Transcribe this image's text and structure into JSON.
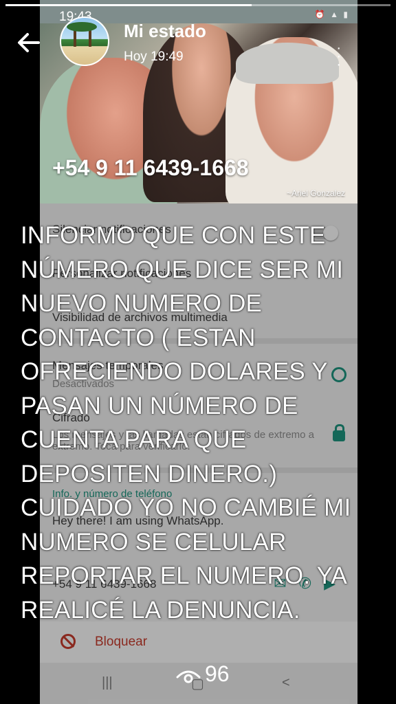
{
  "status": {
    "contact_name": "Mi estado",
    "timestamp": "Hoy 19:49",
    "progress_fraction": 0.64,
    "views_count": "96"
  },
  "caption": {
    "text": "INFORMO QUE CON ESTE\nNÚMERO QUE DICE SER MI\nNUEVO NUMERO DE\nCONTACTO  ( ESTAN\nOFRECIENDO DOLARES Y\nPASAN UN NÚMERO DE\nCUENTA PARA QUE\nDEPOSITEN DINERO.)\nCUIDADO YO NO CAMBIÉ MI\nNUMERO SE CELULAR\nREPORTAR EL NUMERO. YA\nREALICÉ LA DENUNCIA."
  },
  "embedded_screenshot": {
    "phone_status_time": "19:43",
    "photo_phone_number": "+54 9 11 6439-1668",
    "photo_credit": "~Ariel Gonzalez",
    "settings_rows": [
      "Silenciar notificaciones",
      "Personalizar notificaciones",
      "Visibilidad de archivos multimedia",
      "Mensajes temporales",
      "Desactivados",
      "Cifrado",
      "Los mensajes y las llamadas están cifrados de extremo a extremo. Toca para verificarlo.",
      "Info. y número de teléfono",
      "Hey there! I am using WhatsApp.",
      "+54 9 11 6439-1668"
    ],
    "block_label": "Bloquear"
  },
  "icons": {
    "back": "arrow-left-icon",
    "eye": "eye-icon",
    "more": "more-vert-icon"
  },
  "colors": {
    "accent": "#1d8f7b",
    "danger": "#c0392b"
  }
}
